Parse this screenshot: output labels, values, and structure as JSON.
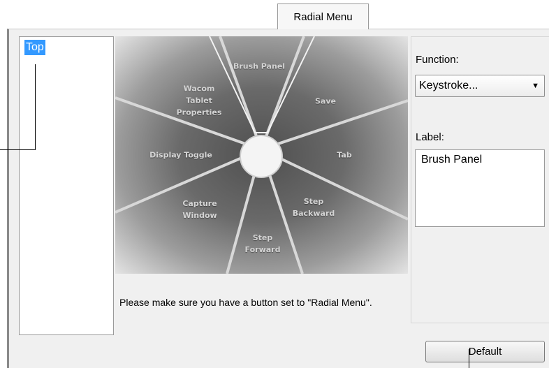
{
  "tab": {
    "label": "Radial Menu"
  },
  "tree": {
    "items": [
      {
        "label": "Top",
        "selected": true
      }
    ]
  },
  "radial_menu": {
    "slices": {
      "top": "Brush Panel",
      "top_right": "Save",
      "right": "Tab",
      "bottom_right": "Step\nBackward",
      "bottom": "Step\nForward",
      "bottom_left": "Capture\nWindow",
      "left": "Display Toggle",
      "top_left": "Wacom\nTablet\nProperties"
    },
    "selected_slice": "top"
  },
  "note": "Please make sure you have a button set to \"Radial Menu\".",
  "function": {
    "label": "Function:",
    "value": "Keystroke..."
  },
  "label_field": {
    "label": "Label:",
    "value": "Brush Panel"
  },
  "default_button": {
    "label": "Default"
  },
  "colors": {
    "selection": "#3399ff",
    "panel_bg": "#f0f0f0"
  }
}
